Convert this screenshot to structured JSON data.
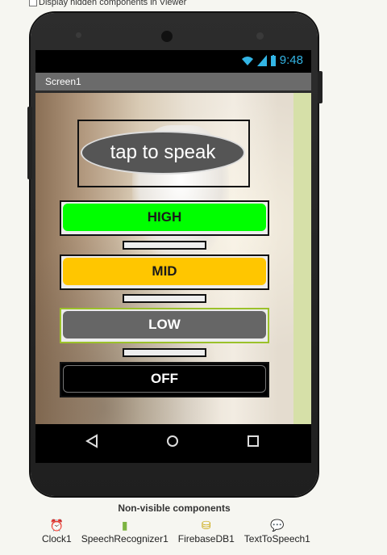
{
  "designer": {
    "checkbox_label": "Display hidden components in Viewer"
  },
  "phone": {
    "status_time": "9:48",
    "screen_title": "Screen1"
  },
  "app": {
    "speak_button": "tap to speak",
    "buttons": [
      {
        "label": "HIGH",
        "color": "#00ff00",
        "text_color": "#1a1a1a"
      },
      {
        "label": "MID",
        "color": "#ffc600",
        "text_color": "#1a1a1a"
      },
      {
        "label": "LOW",
        "color": "#666666",
        "text_color": "#ffffff"
      },
      {
        "label": "OFF",
        "color": "#000000",
        "text_color": "#ffffff"
      }
    ]
  },
  "nav": {
    "back_icon": "back-triangle-icon",
    "home_icon": "home-circle-icon",
    "recent_icon": "recent-square-icon"
  },
  "nonvisible": {
    "title": "Non-visible components",
    "items": [
      {
        "label": "Clock1",
        "icon": "clock-icon"
      },
      {
        "label": "SpeechRecognizer1",
        "icon": "android-icon"
      },
      {
        "label": "FirebaseDB1",
        "icon": "database-icon"
      },
      {
        "label": "TextToSpeech1",
        "icon": "speech-bubble-icon"
      }
    ]
  }
}
